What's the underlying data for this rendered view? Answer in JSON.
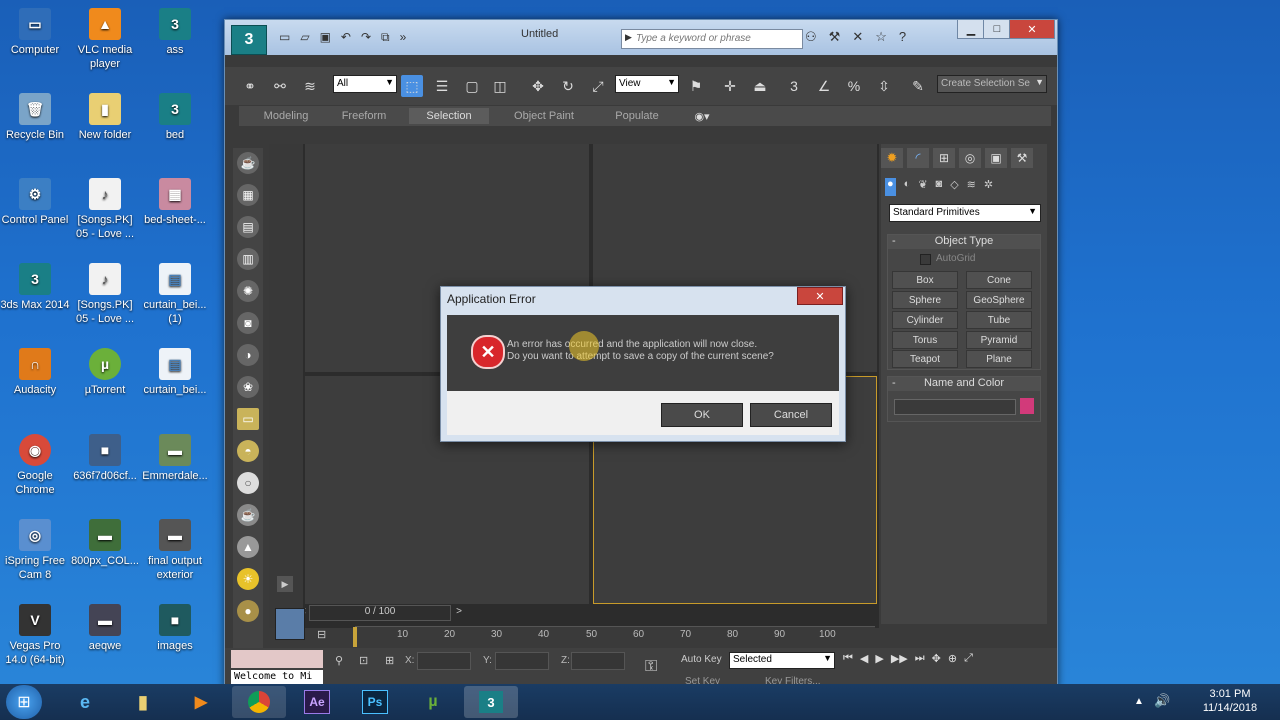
{
  "desktop": {
    "icons": [
      {
        "label": "Computer",
        "glyph": "▭"
      },
      {
        "label": "VLC media player",
        "glyph": "▲"
      },
      {
        "label": "ass",
        "glyph": "3"
      },
      {
        "label": "Recycle Bin",
        "glyph": "🗑"
      },
      {
        "label": "New folder",
        "glyph": "▮"
      },
      {
        "label": "bed",
        "glyph": "3"
      },
      {
        "label": "Control Panel",
        "glyph": "⚙"
      },
      {
        "label": "[Songs.PK] 05 - Love ...",
        "glyph": "♪"
      },
      {
        "label": "bed-sheet-...",
        "glyph": "▦"
      },
      {
        "label": "3ds Max 2014",
        "glyph": "3"
      },
      {
        "label": "[Songs.PK] 05 - Love ...",
        "glyph": "♪"
      },
      {
        "label": "curtain_bei... (1)",
        "glyph": "▤"
      },
      {
        "label": "Audacity",
        "glyph": "∩"
      },
      {
        "label": "µTorrent",
        "glyph": "µ"
      },
      {
        "label": "curtain_bei...",
        "glyph": "▤"
      },
      {
        "label": "Google Chrome",
        "glyph": "◉"
      },
      {
        "label": "636f7d06cf...",
        "glyph": "■"
      },
      {
        "label": "Emmerdale...",
        "glyph": "▬"
      },
      {
        "label": "iSpring Free Cam 8",
        "glyph": "◎"
      },
      {
        "label": "800px_COL...",
        "glyph": "▬"
      },
      {
        "label": "final output exterior",
        "glyph": "▬"
      },
      {
        "label": "Vegas Pro 14.0 (64-bit)",
        "glyph": "V"
      },
      {
        "label": "aeqwe",
        "glyph": "▬"
      },
      {
        "label": "images",
        "glyph": "■"
      }
    ]
  },
  "app": {
    "title": "Untitled",
    "search_placeholder": "Type a keyword or phrase",
    "toolbar": {
      "selection_filter": "All",
      "ref_coord": "View",
      "snaps_label": "3",
      "named_selection": "Create Selection Se"
    },
    "ribbon_tabs": [
      "Modeling",
      "Freeform",
      "Selection",
      "Object Paint",
      "Populate"
    ],
    "active_ribbon_tab": "Selection",
    "command_panel": {
      "category": "Standard Primitives",
      "object_type_header": "Object Type",
      "autogrid": "AutoGrid",
      "buttons": [
        "Box",
        "Cone",
        "Sphere",
        "GeoSphere",
        "Cylinder",
        "Tube",
        "Torus",
        "Pyramid",
        "Teapot",
        "Plane"
      ],
      "name_color_header": "Name and Color",
      "swatch_color": "#d23a7a"
    },
    "timeline": {
      "frame_counter": "0 / 100",
      "ticks": [
        "10",
        "20",
        "30",
        "40",
        "50",
        "60",
        "70",
        "80",
        "90",
        "100"
      ]
    },
    "status": {
      "listener": "Welcome to Mi",
      "x_label": "X:",
      "y_label": "Y:",
      "z_label": "Z:",
      "auto_key": "Auto Key",
      "set_key": "Set Key",
      "selected": "Selected",
      "key_filters": "Key Filters..."
    }
  },
  "dialog": {
    "title": "Application Error",
    "line1": "An error has occurred and the application will now close.",
    "line2": "Do you want to attempt to save a copy of the current scene?",
    "ok": "OK",
    "cancel": "Cancel"
  },
  "taskbar": {
    "time": "3:01 PM",
    "date": "11/14/2018",
    "apps": [
      "Ae",
      "Ps"
    ]
  },
  "colors": {
    "accent_selection": "#4a90e2",
    "error_red": "#d8262b",
    "viewport_highlight": "#c89b2a"
  }
}
